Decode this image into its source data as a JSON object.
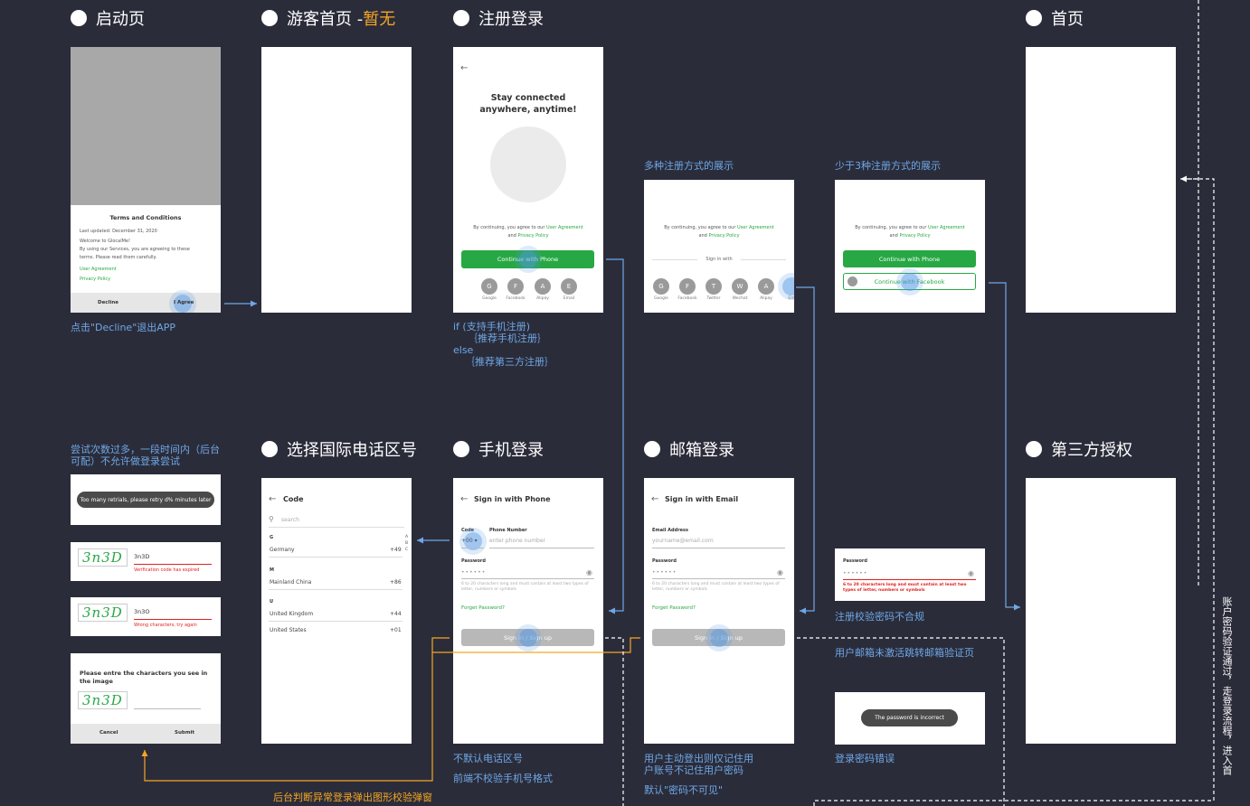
{
  "headings": {
    "launch": "启动页",
    "guest_home": "游客首页 - ",
    "guest_home_accent": "暂无",
    "register_login": "注册登录",
    "home": "首页",
    "choose_code": "选择国际电话区号",
    "phone_login": "手机登录",
    "email_login": "邮箱登录",
    "third_party": "第三方授权"
  },
  "notes": {
    "decline_exit": "点击\"Decline\"退出APP",
    "multi_methods": "多种注册方式的展示",
    "few_methods": "少于3种注册方式的展示",
    "logic_if": "if (支持手机注册)",
    "logic_rec_phone": "｛推荐手机注册｝",
    "logic_else": "else",
    "logic_rec_third": "｛推荐第三方注册｝",
    "too_many_1": "尝试次数过多，一段时间内（后台",
    "too_many_2": "可配）不允许做登录尝试",
    "pwd_invalid": "注册校验密码不合规",
    "email_unactivated": "用户邮箱未激活跳转邮箱验证页",
    "pwd_wrong": "登录密码错误",
    "no_default_code": "不默认电话区号",
    "no_phone_validate": "前端不校验手机号格式",
    "logout_1": "用户主动登出则仅记住用",
    "logout_2": "户账号不记住用户密码",
    "pwd_hidden": "默认\"密码不可见\"",
    "captcha_trigger": "后台判断异常登录弹出图形校验弹窗",
    "vertical": "账户密码验证通过，走登录流程，进入首"
  },
  "terms": {
    "title": "Terms and Conditions",
    "updated": "Last updated: December 31, 2020",
    "welcome": "Welcome to GlocalMe!",
    "body1": "By using our Services, you are agreeing to these",
    "body2": "terms. Please read them carefully.",
    "link_agreement": "User Agreement",
    "link_privacy": "Privacy Policy",
    "decline": "Decline",
    "agree": "I Agree"
  },
  "register": {
    "title1": "Stay connected",
    "title2": "anywhere, anytime!",
    "consent_prefix": "By continuing, you agree to our ",
    "consent_agreement": "User Agreement",
    "consent_and": "and ",
    "consent_privacy": "Privacy Policy",
    "continue_phone": "Continue with Phone",
    "continue_facebook": "Continue with Facebook",
    "sign_in_with": "Sign in with",
    "providers": [
      {
        "letter": "G",
        "name": "Google"
      },
      {
        "letter": "F",
        "name": "Facebook"
      },
      {
        "letter": "A",
        "name": "Alipay"
      },
      {
        "letter": "E",
        "name": "Email"
      }
    ],
    "providers_multi": [
      {
        "letter": "G",
        "name": "Google"
      },
      {
        "letter": "F",
        "name": "Facebook"
      },
      {
        "letter": "T",
        "name": "Twitter"
      },
      {
        "letter": "W",
        "name": "Wechat"
      },
      {
        "letter": "A",
        "name": "Alipay"
      },
      {
        "letter": "",
        "name": "Em"
      }
    ]
  },
  "captcha": {
    "toast_retry": "Too many retrials, please retry d% minutes later",
    "code_image": "3n3D",
    "input1": "3n3D",
    "err_expired": "Verification code has expired",
    "input2": "3n3O",
    "err_wrong": "Wrong characters, try again",
    "dialog_prompt": "Please entre the characters you see in the image",
    "cancel": "Cancel",
    "submit": "Submit"
  },
  "code_picker": {
    "title": "Code",
    "search": "search",
    "index": [
      "A",
      "B",
      "C"
    ],
    "groups": [
      {
        "letter": "G",
        "items": [
          {
            "name": "Germany",
            "code": "+49"
          }
        ]
      },
      {
        "letter": "M",
        "items": [
          {
            "name": "Mainland China",
            "code": "+86"
          }
        ]
      },
      {
        "letter": "U",
        "items": [
          {
            "name": "United Kingdom",
            "code": "+44"
          },
          {
            "name": "United States",
            "code": "+01"
          }
        ]
      }
    ]
  },
  "phone_login": {
    "title": "Sign in with Phone",
    "code_label": "Code",
    "code_value": "+00",
    "phone_label": "Phone Number",
    "phone_placeholder": "enter phone number",
    "password_label": "Password",
    "password_mask": "••••••",
    "hint": "6 to 20 characters long and must contain at least two types of letter, numbers or symbols",
    "forget": "Forget Password?",
    "submit": "Sign in / Sign up"
  },
  "email_login": {
    "title": "Sign in with Email",
    "email_label": "Email Address",
    "email_placeholder": "yourname@email.com",
    "password_label": "Password",
    "password_mask": "••••••",
    "hint": "6 to 20 characters long and must contain at least two types of letter, numbers or symbols",
    "forget": "Forget Password?",
    "submit": "Sign in / Sign up"
  },
  "pwd_error": {
    "label": "Password",
    "mask": "••••••",
    "error": "6 to 20 characters long and must contain at least two types of letter, numbers or symbols"
  },
  "pwd_incorrect": "The password is incorrect",
  "colors": {
    "background": "#2b2c3a",
    "accent": "#f5a623",
    "green": "#27a844",
    "note_blue": "#6ea8e6",
    "error_red": "#e02020"
  }
}
